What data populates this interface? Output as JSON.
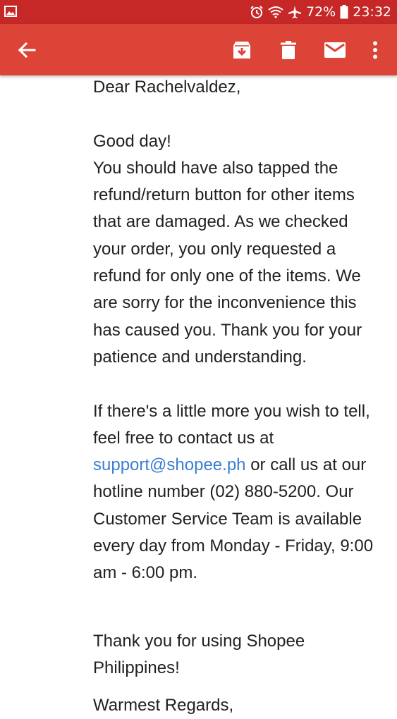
{
  "status_bar": {
    "battery_percent": "72%",
    "time": "23:32",
    "icons": [
      "gallery-icon",
      "alarm-icon",
      "wifi-icon",
      "airplane-icon",
      "battery-icon"
    ]
  },
  "app_bar": {
    "icons": [
      "back-arrow-icon",
      "archive-icon",
      "delete-icon",
      "mark-unread-icon",
      "more-vert-icon"
    ],
    "color": "#db4437"
  },
  "email": {
    "greeting": "Dear Rachelvaldez,",
    "line1": "Good day!",
    "para1": "You should have also tapped the refund/return button for other items that are damaged. As we checked your order, you only requested a refund for only one of the items. We are sorry for the inconvenience this has caused you. Thank you for your patience and understanding.",
    "para2_before_link": "If there's a little more you wish to tell, feel free to contact us at",
    "link": "support@shopee.ph",
    "para2_after_link": "or call us at our hotline number (02) 880-5200. Our Customer Service Team is available every day from Monday - Friday, 9:00 am - 6:00 pm.",
    "closing": "Thank you for using Shopee Philippines!",
    "cut_off_line": "Warmest Regards,"
  },
  "link_color": "#3b7fd1"
}
